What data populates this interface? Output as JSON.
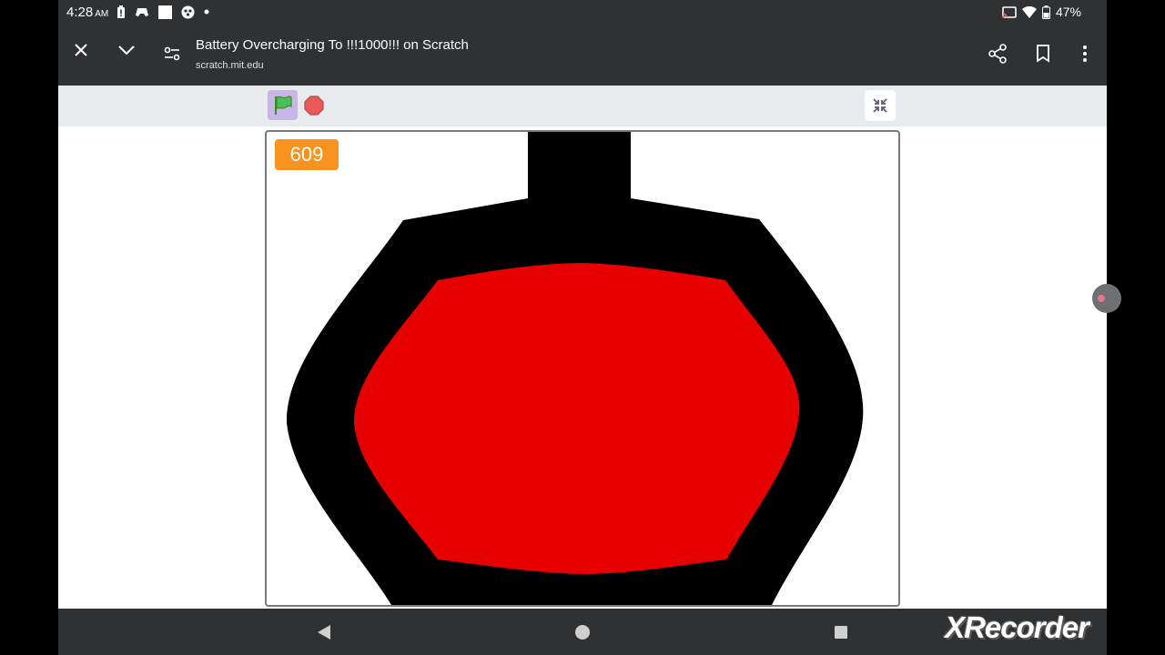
{
  "status_bar": {
    "time": "4:28",
    "am_pm": "AM",
    "battery": "47%"
  },
  "browser": {
    "title": "Battery Overcharging To !!!1000!!! on Scratch",
    "url": "scratch.mit.edu"
  },
  "stage": {
    "counter_value": "609",
    "colors": {
      "battery_shell": "#000000",
      "battery_fill": "#e60000",
      "counter_bg": "#f7931e"
    }
  },
  "watermark": {
    "text": "XRecorder"
  },
  "icons": {
    "close": "close-icon",
    "collapse": "chevron-down-icon",
    "page_settings": "tune-icon",
    "share": "share-icon",
    "bookmark": "bookmark-icon",
    "menu": "more-vert-icon",
    "green_flag": "green-flag-icon",
    "stop": "stop-icon",
    "exit_fullscreen": "exit-fullscreen-icon",
    "nav_back": "back-triangle-icon",
    "nav_home": "home-circle-icon",
    "nav_recents": "recents-square-icon"
  }
}
